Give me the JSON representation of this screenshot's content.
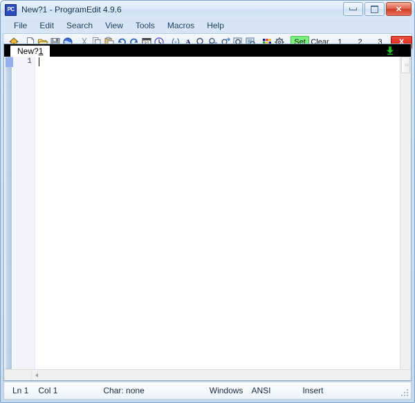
{
  "window": {
    "title": "New?1  -  ProgramEdit 4.9.6",
    "app_icon_label": "PC",
    "controls": {
      "minimize": "minimize-button",
      "maximize": "maximize-button",
      "close_label": "✕"
    }
  },
  "menubar": {
    "items": [
      {
        "label": "File"
      },
      {
        "label": "Edit"
      },
      {
        "label": "Search"
      },
      {
        "label": "View"
      },
      {
        "label": "Tools"
      },
      {
        "label": "Macros"
      },
      {
        "label": "Help"
      }
    ]
  },
  "toolbar": {
    "icons": [
      {
        "name": "home-icon",
        "title": "Home"
      },
      {
        "name": "new-file-icon",
        "title": "New"
      },
      {
        "name": "open-folder-icon",
        "title": "Open"
      },
      {
        "name": "save-icon",
        "title": "Save"
      },
      {
        "name": "web-browser-icon",
        "title": "Open in browser"
      },
      {
        "name": "cut-icon",
        "title": "Cut"
      },
      {
        "name": "copy-icon",
        "title": "Copy"
      },
      {
        "name": "paste-icon",
        "title": "Paste"
      },
      {
        "name": "undo-icon",
        "title": "Undo"
      },
      {
        "name": "redo-icon",
        "title": "Redo"
      },
      {
        "name": "calendar-icon",
        "title": "Insert date"
      },
      {
        "name": "clock-icon",
        "title": "Insert time"
      },
      {
        "name": "brackets-icon",
        "title": "Match bracket"
      },
      {
        "name": "font-color-icon",
        "title": "Font"
      },
      {
        "name": "find-icon",
        "title": "Find"
      },
      {
        "name": "find-next-icon",
        "title": "Find next"
      },
      {
        "name": "replace-icon",
        "title": "Replace"
      },
      {
        "name": "find-in-files-icon",
        "title": "Find in files"
      },
      {
        "name": "goto-icon",
        "title": "Go to"
      },
      {
        "name": "color-palette-icon",
        "title": "Colors"
      },
      {
        "name": "settings-gear-icon",
        "title": "Settings"
      }
    ],
    "calendar_day": "31",
    "font_letter": "A",
    "buttons": {
      "set": "Set",
      "clear": "Clear",
      "bookmark1": "1",
      "bookmark2": "2",
      "bookmark3": "3",
      "close_doc": "X"
    },
    "set_button_color": "#7cf07c",
    "close_button_color": "#cf1c10"
  },
  "tabs": {
    "items": [
      {
        "label_prefix": "New?",
        "label_suffix": "1"
      }
    ],
    "strip_color": "#000000",
    "action_icon": "download-arrow-icon"
  },
  "editor": {
    "line_numbers": [
      "1"
    ],
    "content": "",
    "bookmark_marker_color": "#93aeec"
  },
  "statusbar": {
    "line": "Ln 1",
    "column": "Col 1",
    "character": "Char: none",
    "line_ending": "Windows",
    "encoding": "ANSI",
    "insert_mode": "Insert"
  }
}
